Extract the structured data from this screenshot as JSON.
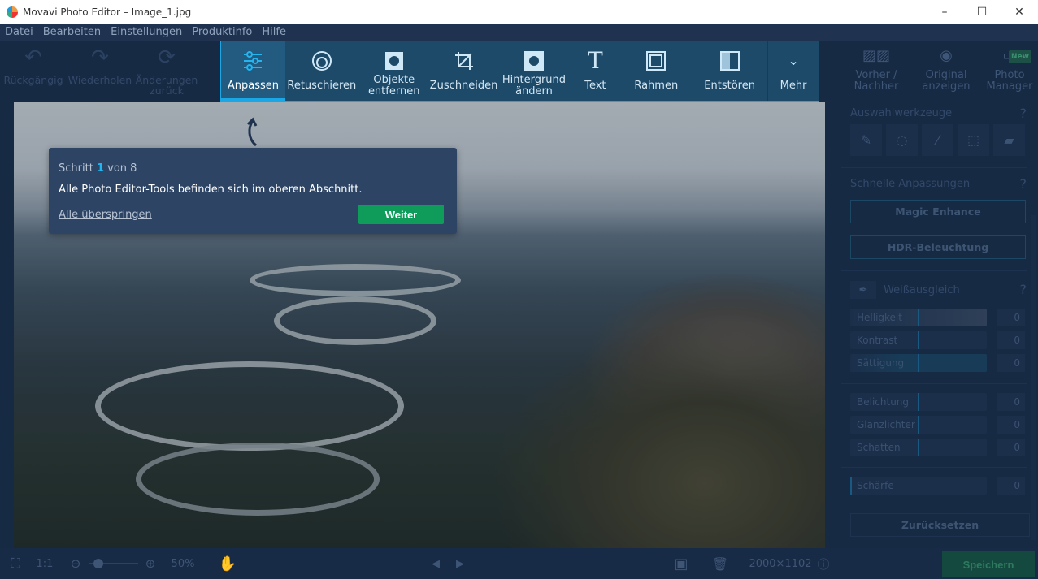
{
  "window": {
    "title": "Movavi Photo Editor – Image_1.jpg",
    "minimize": "–",
    "maximize": "☐",
    "close": "✕"
  },
  "menu": [
    "Datei",
    "Bearbeiten",
    "Einstellungen",
    "Produktinfo",
    "Hilfe"
  ],
  "history": [
    {
      "label": "Rückgängig",
      "icon": "undo-icon"
    },
    {
      "label": "Wiederholen",
      "icon": "redo-icon"
    },
    {
      "label": "Änderungen zurück",
      "icon": "reset-icon"
    }
  ],
  "tools": [
    {
      "label": "Anpassen",
      "active": true
    },
    {
      "label": "Retuschieren"
    },
    {
      "label": "Objekte entfernen"
    },
    {
      "label": "Zuschneiden"
    },
    {
      "label": "Hintergrund ändern"
    },
    {
      "label": "Text"
    },
    {
      "label": "Rahmen"
    },
    {
      "label": "Entstören"
    },
    {
      "label": "Mehr"
    }
  ],
  "view": [
    {
      "label": "Vorher / Nachher"
    },
    {
      "label": "Original anzeigen"
    },
    {
      "label": "Photo Manager",
      "badge": "New"
    }
  ],
  "tour": {
    "step_prefix": "Schritt",
    "step": "1",
    "step_suffix": "von 8",
    "message": "Alle Photo Editor-Tools befinden sich im oberen Abschnitt.",
    "skip": "Alle überspringen",
    "next": "Weiter"
  },
  "panel": {
    "selection_title": "Auswahlwerkzeuge",
    "quick_title": "Schnelle Anpassungen",
    "magic": "Magic Enhance",
    "hdr": "HDR-Beleuchtung",
    "wb": "Weißausgleich",
    "help": "?",
    "sliders": [
      {
        "label": "Helligkeit",
        "value": "0"
      },
      {
        "label": "Kontrast",
        "value": "0"
      },
      {
        "label": "Sättigung",
        "value": "0"
      },
      {
        "label": "Belichtung",
        "value": "0"
      },
      {
        "label": "Glanzlichter",
        "value": "0"
      },
      {
        "label": "Schatten",
        "value": "0"
      },
      {
        "label": "Schärfe",
        "value": "0"
      }
    ],
    "reset": "Zurücksetzen"
  },
  "bottom": {
    "ratio": "1:1",
    "zoom": "50%",
    "zoom_level": 0.1,
    "dimensions": "2000×1102",
    "save": "Speichern"
  },
  "colors": {
    "accent": "#1aa7e6",
    "green": "#0f9b59"
  }
}
